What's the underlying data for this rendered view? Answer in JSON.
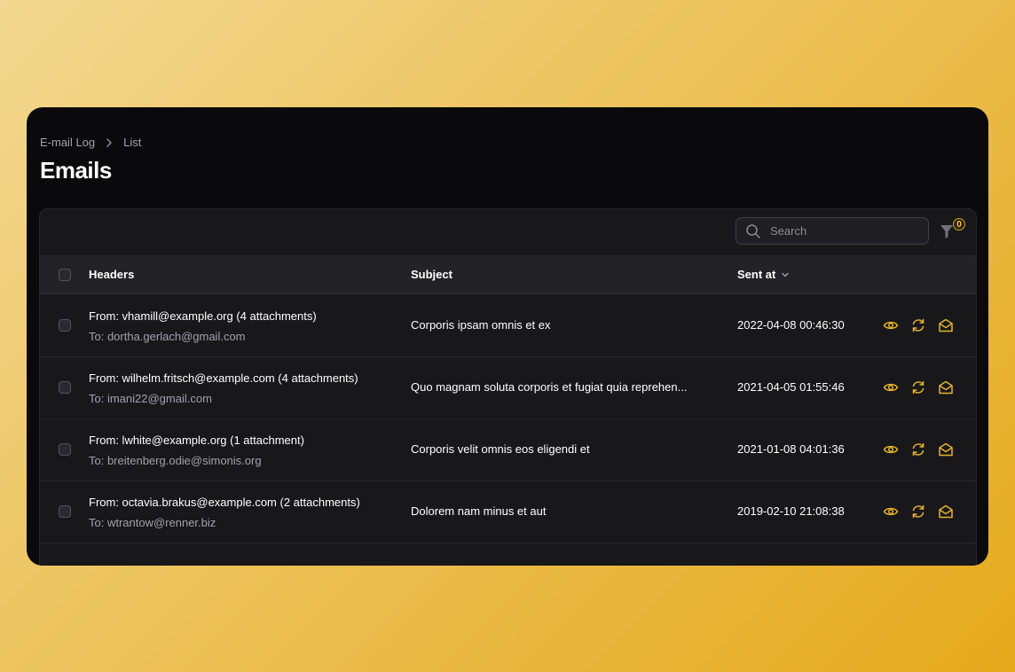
{
  "breadcrumb": {
    "items": [
      "E-mail Log",
      "List"
    ]
  },
  "page": {
    "title": "Emails"
  },
  "search": {
    "placeholder": "Search",
    "value": ""
  },
  "filter": {
    "count": "0"
  },
  "table": {
    "columns": {
      "headers": "Headers",
      "subject": "Subject",
      "sent_at": "Sent at"
    },
    "rows": [
      {
        "from": "From: vhamill@example.org (4 attachments)",
        "to": "To: dortha.gerlach@gmail.com",
        "subject": "Corporis ipsam omnis et ex",
        "sent_at": "2022-04-08 00:46:30"
      },
      {
        "from": "From: wilhelm.fritsch@example.com (4 attachments)",
        "to": "To: imani22@gmail.com",
        "subject": "Quo magnam soluta corporis et fugiat quia reprehen...",
        "sent_at": "2021-04-05 01:55:46"
      },
      {
        "from": "From: lwhite@example.org (1 attachment)",
        "to": "To: breitenberg.odie@simonis.org",
        "subject": "Corporis velit omnis eos eligendi et",
        "sent_at": "2021-01-08 04:01:36"
      },
      {
        "from": "From: octavia.brakus@example.com (2 attachments)",
        "to": "To: wtrantow@renner.biz",
        "subject": "Dolorem nam minus et aut",
        "sent_at": "2019-02-10 21:08:38"
      }
    ]
  },
  "icons": {
    "breadcrumb_separator": "chevron-right-icon",
    "search": "magnifier-icon",
    "filter": "funnel-icon",
    "sort": "chevron-down-icon",
    "row_actions": [
      "eye-icon",
      "refresh-icon",
      "envelope-open-icon"
    ]
  },
  "colors": {
    "accent": "#e5b22b",
    "background": "#0a0a0c",
    "card": "#18181b"
  }
}
